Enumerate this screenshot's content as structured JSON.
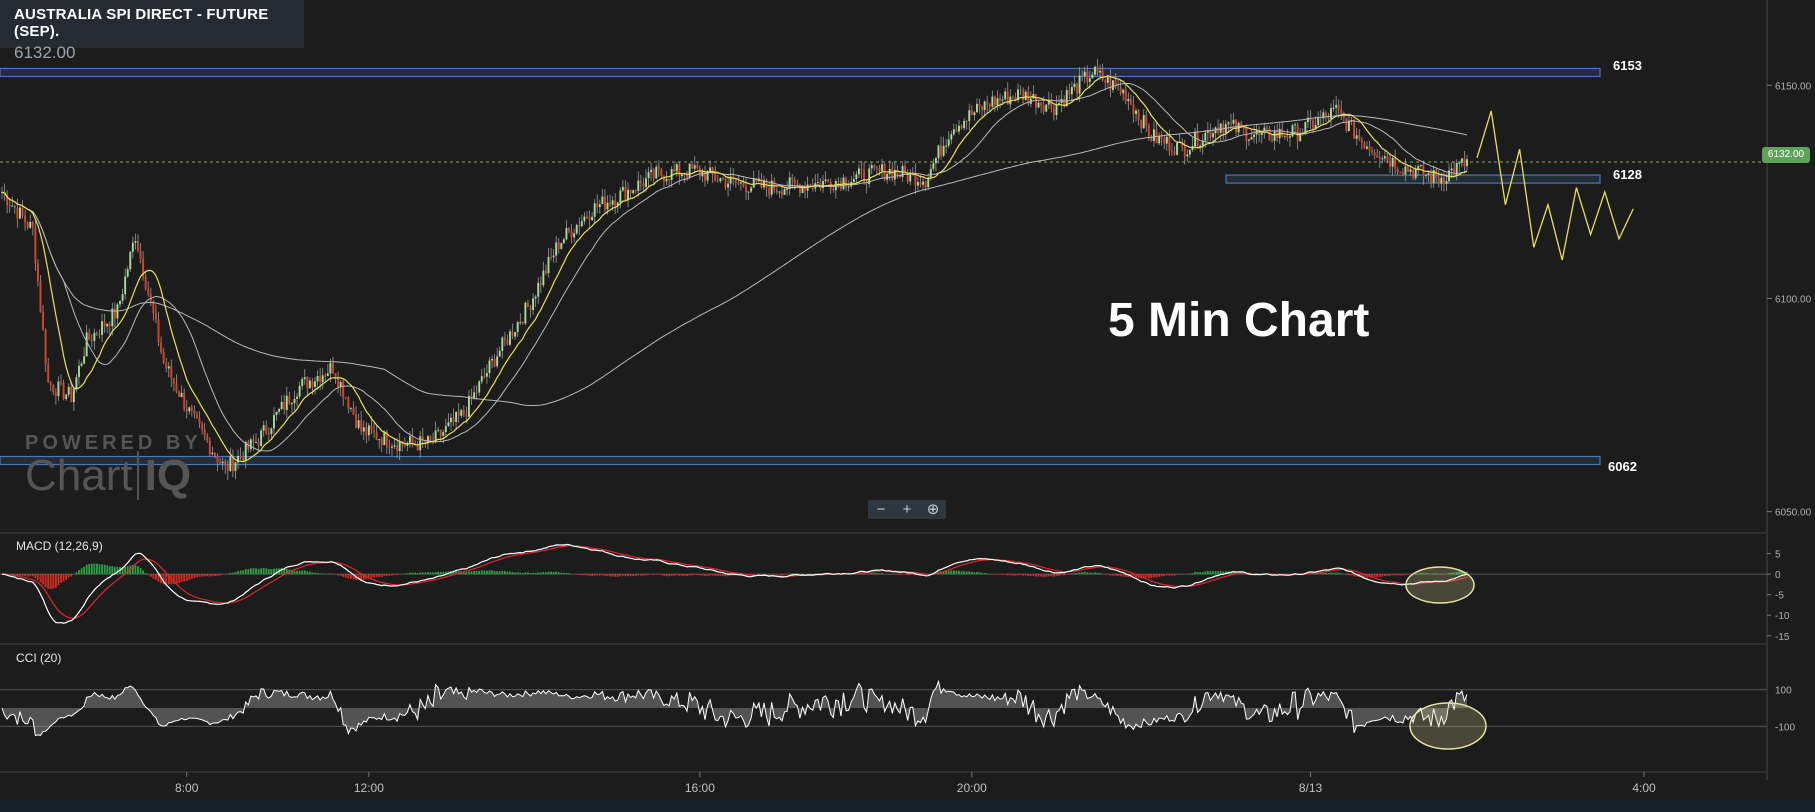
{
  "header": {
    "instrument": "AUSTRALIA SPI DIRECT - FUTURE (SEP).",
    "price": "6132.00"
  },
  "annotation": "5 Min Chart",
  "branding": {
    "powered_by": "POWERED BY",
    "logo_a": "Chart",
    "logo_b": "IQ"
  },
  "zoom": {
    "out": "−",
    "in": "+",
    "reset": "⊕"
  },
  "colors": {
    "background": "#1c1c1c",
    "up_candle": "#a6dd9a",
    "down_candle": "#d9452b",
    "ma_fast": "#e8e05a",
    "ma_slow": "#b9b9b9",
    "level_band": "#4a78b8",
    "projection": "#e8e05a",
    "macd_line": "#ffffff",
    "signal_line": "#e0262a",
    "hist_up": "#2ea043",
    "hist_down": "#d62d20",
    "price_tag": "#5fa35a",
    "highlight": "#e8e4a0"
  },
  "chart_data": [
    {
      "type": "candlestick",
      "panel": "price",
      "x_ticks": [
        "8:00",
        "12:00",
        "16:00",
        "20:00",
        "8/13",
        "4:00",
        "8:00"
      ],
      "y_ticks": [
        "6150.00",
        "6100.00",
        "6050.00"
      ],
      "ylim": [
        6045,
        6170
      ],
      "current_price": "6132.00",
      "levels": [
        {
          "label": "6153",
          "value": 6153
        },
        {
          "label": "6128",
          "value": 6128
        },
        {
          "label": "6062",
          "value": 6062
        }
      ],
      "close_path": [
        [
          0,
          6125
        ],
        [
          12,
          6116
        ],
        [
          18,
          6080
        ],
        [
          27,
          6077
        ],
        [
          33,
          6090
        ],
        [
          45,
          6097
        ],
        [
          52,
          6115
        ],
        [
          63,
          6085
        ],
        [
          75,
          6071
        ],
        [
          87,
          6060
        ],
        [
          100,
          6067
        ],
        [
          115,
          6079
        ],
        [
          129,
          6084
        ],
        [
          140,
          6069
        ],
        [
          155,
          6066
        ],
        [
          167,
          6066
        ],
        [
          180,
          6073
        ],
        [
          192,
          6086
        ],
        [
          205,
          6098
        ],
        [
          217,
          6113
        ],
        [
          230,
          6121
        ],
        [
          243,
          6125
        ],
        [
          255,
          6129
        ],
        [
          270,
          6130
        ],
        [
          285,
          6127
        ],
        [
          300,
          6126
        ],
        [
          318,
          6127
        ],
        [
          330,
          6128
        ],
        [
          345,
          6130
        ],
        [
          360,
          6128
        ],
        [
          370,
          6140
        ],
        [
          385,
          6146
        ],
        [
          397,
          6148
        ],
        [
          410,
          6145
        ],
        [
          425,
          6153
        ],
        [
          438,
          6148
        ],
        [
          448,
          6138
        ],
        [
          460,
          6135
        ],
        [
          475,
          6141
        ],
        [
          490,
          6138
        ],
        [
          505,
          6139
        ],
        [
          520,
          6144
        ],
        [
          530,
          6137
        ],
        [
          545,
          6131
        ],
        [
          560,
          6128
        ],
        [
          571,
          6132
        ]
      ],
      "projection": [
        6133,
        6144,
        6122,
        6135,
        6112,
        6122,
        6109,
        6126,
        6115,
        6125,
        6114,
        6121
      ]
    },
    {
      "type": "line",
      "panel": "indicator",
      "title": "MACD (12,26,9)",
      "y_ticks": [
        "5",
        "0",
        "-5",
        "-10",
        "-15"
      ],
      "ylim": [
        -17,
        10
      ]
    },
    {
      "type": "line",
      "panel": "indicator",
      "title": "CCI (20)",
      "y_ticks": [
        "100",
        "-100"
      ],
      "ylim": [
        -350,
        350
      ]
    }
  ]
}
